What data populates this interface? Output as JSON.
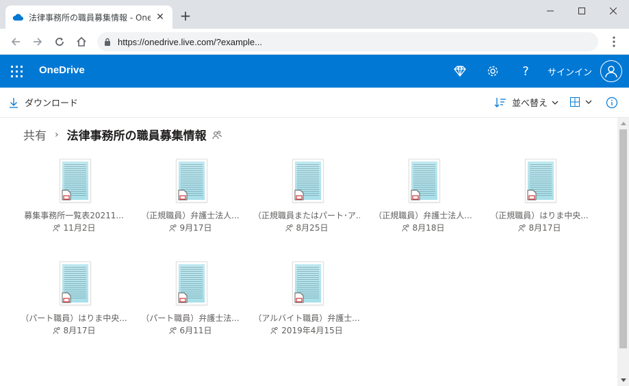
{
  "browser": {
    "tab_title": "法律事務所の職員募集情報 - One",
    "url": "https://onedrive.live.com/?example..."
  },
  "header": {
    "brand": "OneDrive",
    "signin": "サインイン",
    "accent": "#0078d4"
  },
  "commandbar": {
    "download": "ダウンロード",
    "sort": "並べ替え"
  },
  "breadcrumb": {
    "root": "共有",
    "current": "法律事務所の職員募集情報"
  },
  "files": [
    {
      "name": "募集事務所一覧表20211...",
      "date": "11月2日"
    },
    {
      "name": "（正規職員）弁護士法人...",
      "date": "9月17日"
    },
    {
      "name": "（正規職員またはパート･ア...",
      "date": "8月25日"
    },
    {
      "name": "（正規職員）弁護士法人...",
      "date": "8月18日"
    },
    {
      "name": "（正規職員）はりま中央...",
      "date": "8月17日"
    },
    {
      "name": "（パート職員）はりま中央...",
      "date": "8月17日"
    },
    {
      "name": "（パート職員）弁護士法...",
      "date": "6月11日"
    },
    {
      "name": "（アルバイト職員）弁護士...",
      "date": "2019年4月15日"
    }
  ]
}
